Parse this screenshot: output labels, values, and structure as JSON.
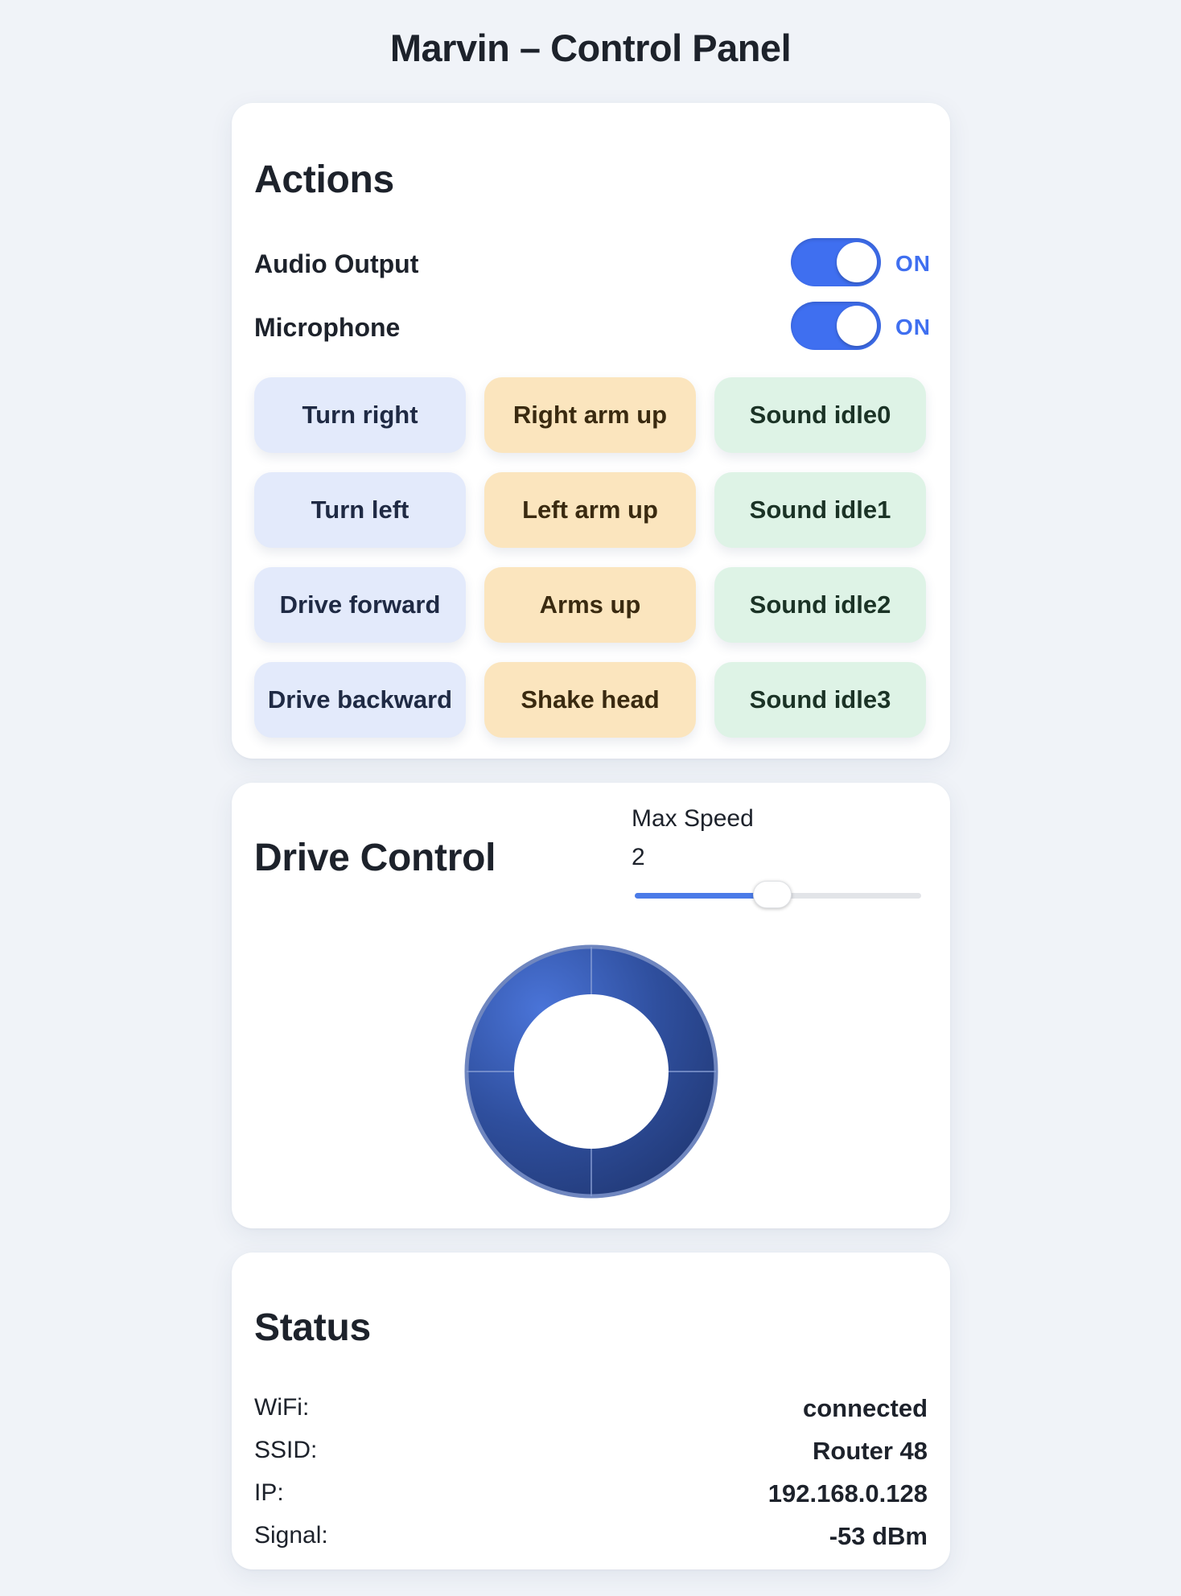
{
  "page": {
    "title": "Marvin – Control Panel"
  },
  "actions": {
    "title": "Actions",
    "toggles": [
      {
        "label": "Audio Output",
        "state": "ON"
      },
      {
        "label": "Microphone",
        "state": "ON"
      }
    ],
    "buttons": [
      {
        "label": "Turn right",
        "color": "blue"
      },
      {
        "label": "Right arm up",
        "color": "orange"
      },
      {
        "label": "Sound idle0",
        "color": "green"
      },
      {
        "label": "Turn left",
        "color": "blue"
      },
      {
        "label": "Left arm up",
        "color": "orange"
      },
      {
        "label": "Sound idle1",
        "color": "green"
      },
      {
        "label": "Drive forward",
        "color": "blue"
      },
      {
        "label": "Arms up",
        "color": "orange"
      },
      {
        "label": "Sound idle2",
        "color": "green"
      },
      {
        "label": "Drive backward",
        "color": "blue"
      },
      {
        "label": "Shake head",
        "color": "orange"
      },
      {
        "label": "Sound idle3",
        "color": "green"
      }
    ]
  },
  "drive": {
    "title": "Drive Control",
    "speed_label": "Max Speed",
    "speed_value": "2",
    "speed_fraction": 0.48,
    "joystick_icon": "joystick-ring-icon"
  },
  "status": {
    "title": "Status",
    "rows": [
      {
        "key": "WiFi:",
        "value": "connected"
      },
      {
        "key": "SSID:",
        "value": "Router 48"
      },
      {
        "key": "IP:",
        "value": "192.168.0.128"
      },
      {
        "key": "Signal:",
        "value": "-53 dBm"
      }
    ]
  },
  "colors": {
    "accent": "#3f6ff0",
    "background": "#f0f3f8",
    "button_blue": "#e3eafb",
    "button_orange": "#fbe5be",
    "button_green": "#def3e6",
    "joystick_ring": "#2f4f9e"
  }
}
